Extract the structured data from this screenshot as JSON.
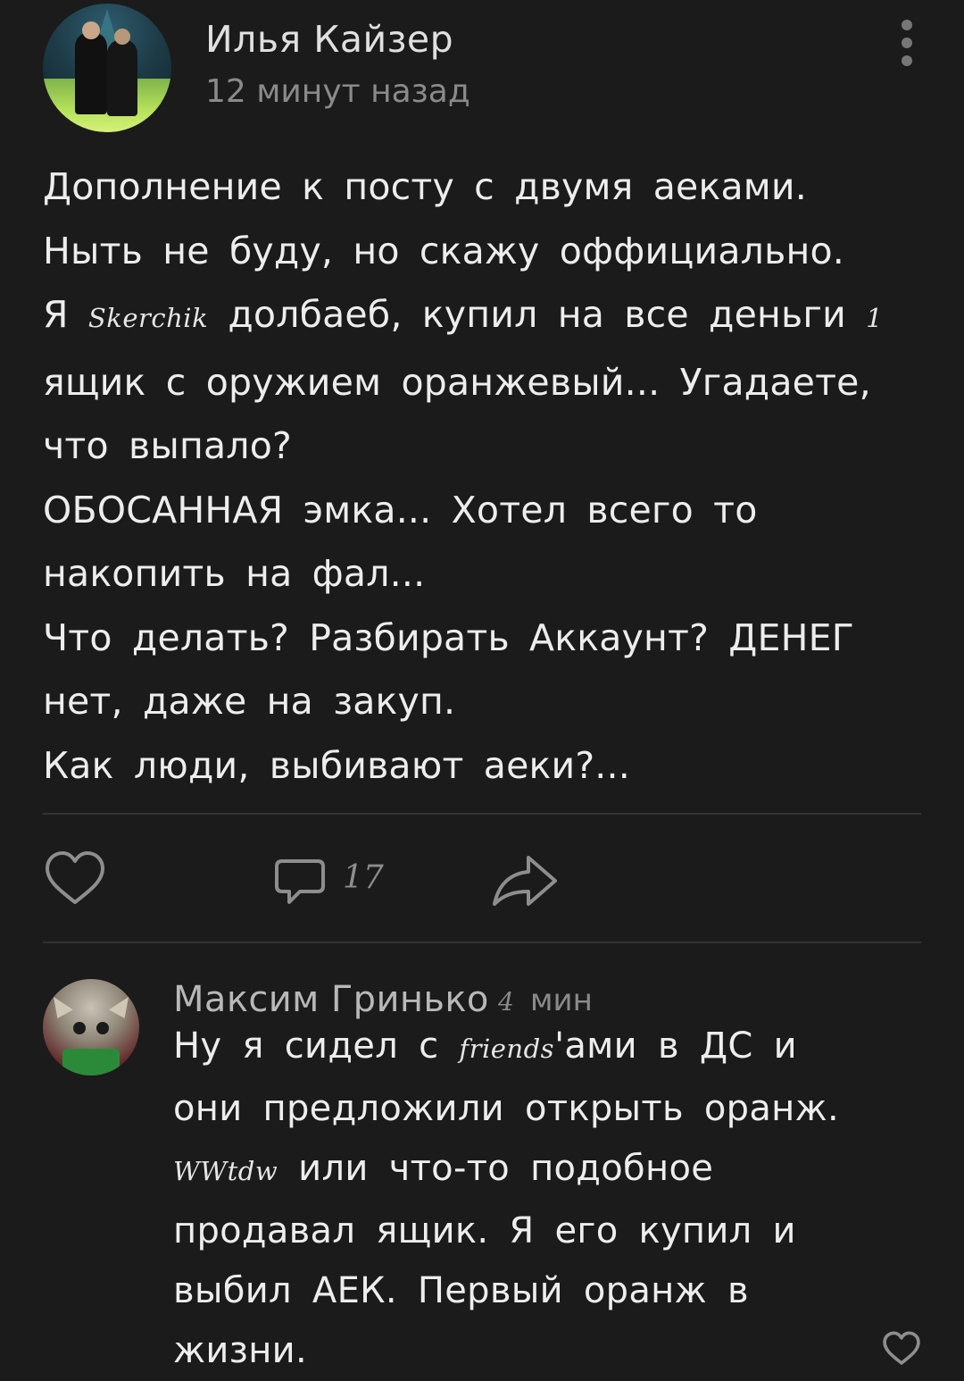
{
  "post": {
    "author": "Илья Кайзер",
    "time": "12 минут назад",
    "lines": [
      [
        "Дополнение к посту с двумя аеками."
      ],
      [
        "Ныть не буду, но скажу оффициально."
      ],
      [
        "Я ",
        "Skerchik",
        " долбаеб, купил на все деньги ",
        "1"
      ],
      [
        "ящик с оружием оранжевый... Угадаете,"
      ],
      [
        "что выпало?"
      ],
      [
        "ОБОСАННАЯ эмка... Хотел всего то"
      ],
      [
        "накопить на фал..."
      ],
      [
        "Что делать? Разбирать Аккаунт? ДЕНЕГ"
      ],
      [
        "нет, даже на закуп."
      ],
      [
        "Как люди, выбивают аеки?..."
      ]
    ]
  },
  "actions": {
    "comment_count": "17"
  },
  "comment": {
    "author": "Максим Гринько",
    "time_number": "4",
    "time_unit": "мин",
    "lines": [
      [
        "Ну я сидел с ",
        "friends",
        "'ами в ДС и"
      ],
      [
        "они предложили открыть оранж."
      ],
      [
        "",
        "WWtdw",
        " или что-то подобное"
      ],
      [
        "продавал ящик. Я его купил и"
      ],
      [
        "выбил АЕК. Первый оранж в"
      ],
      [
        "жизни."
      ]
    ]
  },
  "colors": {
    "background": "#1b1b1b",
    "text": "#ededed",
    "secondary": "#8a8a8a",
    "divider": "#333333",
    "icon": "#8e8e8e"
  }
}
